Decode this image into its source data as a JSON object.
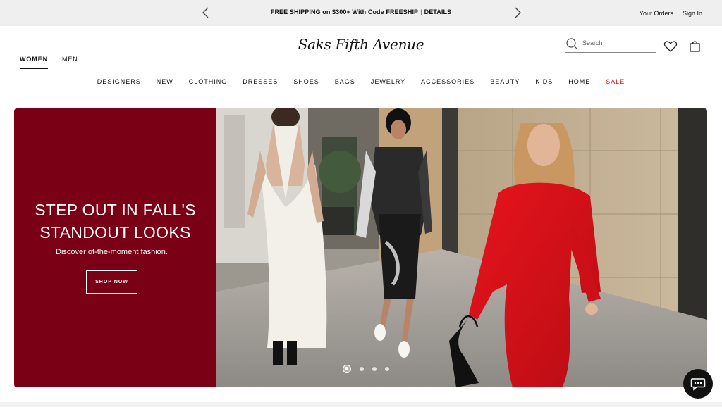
{
  "promo": {
    "prev_icon": "chevron-left-icon",
    "next_icon": "chevron-right-icon",
    "text": "FREE SHIPPING on $300+ With Code FREESHIP",
    "separator": "|",
    "link": "DETAILS"
  },
  "utility": {
    "orders": "Your Orders",
    "signin": "Sign In"
  },
  "header": {
    "tabs": [
      {
        "label": "WOMEN",
        "active": true
      },
      {
        "label": "MEN",
        "active": false
      }
    ],
    "logo": "Saks Fifth Avenue",
    "search_placeholder": "Search",
    "icons": [
      "search-icon",
      "heart-icon",
      "shopping-bag-icon"
    ]
  },
  "nav": {
    "items": [
      "DESIGNERS",
      "NEW",
      "CLOTHING",
      "DRESSES",
      "SHOES",
      "BAGS",
      "JEWELRY",
      "ACCESSORIES",
      "BEAUTY",
      "KIDS",
      "HOME",
      "SALE"
    ],
    "sale_color": "#d21c1c"
  },
  "hero": {
    "title_line1": "STEP OUT IN FALL'S",
    "title_line2": "STANDOUT LOOKS",
    "subtitle": "Discover of-the-moment fashion.",
    "cta": "SHOP NOW",
    "panel_color": "#7a0016",
    "slides_total": 4,
    "active_slide": 1
  },
  "chat": {
    "icon": "chat-bubble-icon"
  }
}
